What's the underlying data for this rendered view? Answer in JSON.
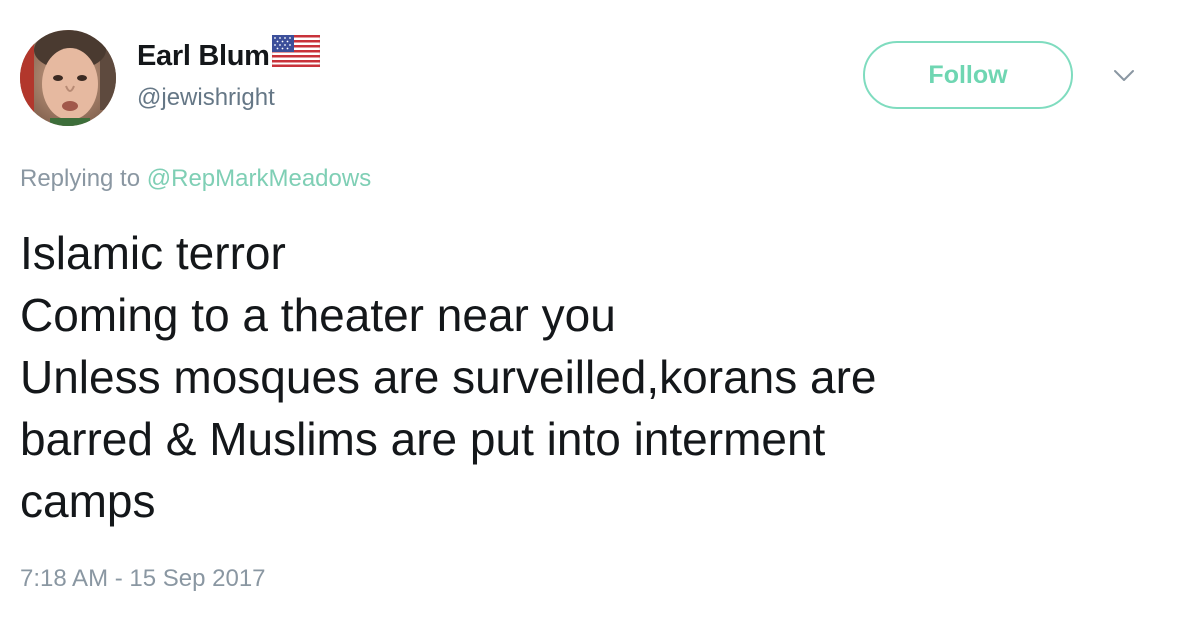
{
  "user": {
    "display_name": "Earl Blum",
    "flag_icon": "us-flag-icon",
    "handle": "@jewishright"
  },
  "follow_button": {
    "label": "Follow",
    "color": "#6fd6b2"
  },
  "reply": {
    "prefix": "Replying to",
    "to_handle": "@RepMarkMeadows"
  },
  "tweet": {
    "lines": [
      "Islamic terror",
      "Coming to a theater near you",
      "Unless mosques are surveilled,korans are",
      "barred & Muslims are put into interment",
      "camps"
    ]
  },
  "timestamp": "7:18 AM - 15 Sep 2017"
}
